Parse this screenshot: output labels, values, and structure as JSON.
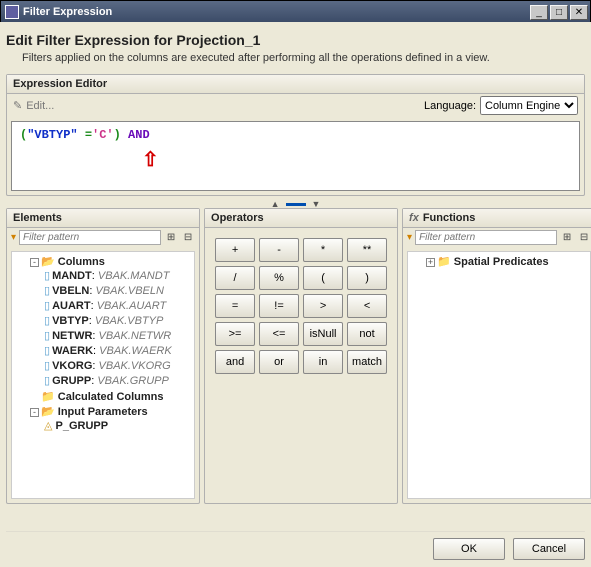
{
  "window": {
    "title": "Filter Expression"
  },
  "header": {
    "title": "Edit Filter Expression for Projection_1",
    "subtitle": "Filters applied on the columns are executed after performing all the operations defined in a view."
  },
  "editor": {
    "panel_title": "Expression Editor",
    "edit_label": "Edit...",
    "language_label": "Language:",
    "language_value": "Column Engine",
    "language_options": [
      "Column Engine"
    ],
    "expr": {
      "p1": "(",
      "colname": "\"VBTYP\"",
      "eq": " =",
      "val": "'C'",
      "p2": ")",
      "kw": " AND"
    }
  },
  "elements": {
    "panel_title": "Elements",
    "filter_placeholder": "Filter pattern",
    "tree": {
      "columns_label": "Columns",
      "items": [
        {
          "name": "MANDT",
          "src": "VBAK.MANDT"
        },
        {
          "name": "VBELN",
          "src": "VBAK.VBELN"
        },
        {
          "name": "AUART",
          "src": "VBAK.AUART"
        },
        {
          "name": "VBTYP",
          "src": "VBAK.VBTYP"
        },
        {
          "name": "NETWR",
          "src": "VBAK.NETWR"
        },
        {
          "name": "WAERK",
          "src": "VBAK.WAERK"
        },
        {
          "name": "VKORG",
          "src": "VBAK.VKORG"
        },
        {
          "name": "GRUPP",
          "src": "VBAK.GRUPP"
        }
      ],
      "calc_label": "Calculated Columns",
      "inparams_label": "Input Parameters",
      "param_item": "P_GRUPP"
    }
  },
  "operators": {
    "panel_title": "Operators",
    "buttons": [
      "+",
      "-",
      "*",
      "**",
      "/",
      "%",
      "(",
      ")",
      "=",
      "!=",
      ">",
      "<",
      ">=",
      "<=",
      "isNull",
      "not",
      "and",
      "or",
      "in",
      "match"
    ]
  },
  "functions": {
    "panel_title": "Functions",
    "filter_placeholder": "Filter pattern",
    "item": "Spatial Predicates"
  },
  "footer": {
    "ok": "OK",
    "cancel": "Cancel"
  }
}
